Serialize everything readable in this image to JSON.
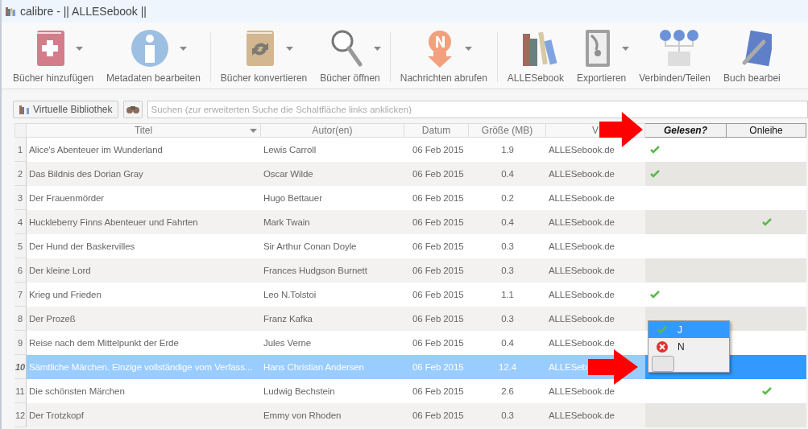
{
  "window": {
    "title": "calibre - || ALLESebook ||"
  },
  "toolbar": [
    {
      "label": "Bücher hinzufügen",
      "kind": "add-book",
      "menu": true,
      "separator_before": false
    },
    {
      "label": "Metadaten bearbeiten",
      "kind": "info",
      "menu": true,
      "separator_before": false
    },
    {
      "label": "Bücher konvertieren",
      "kind": "convert",
      "menu": true,
      "separator_before": true
    },
    {
      "label": "Bücher öffnen",
      "kind": "magnifier",
      "menu": true,
      "separator_before": false
    },
    {
      "label": "Nachrichten abrufen",
      "kind": "news",
      "menu": true,
      "separator_before": true
    },
    {
      "label": "ALLESebook",
      "kind": "library",
      "menu": false,
      "separator_before": true
    },
    {
      "label": "Exportieren",
      "kind": "drive",
      "menu": true,
      "separator_before": false
    },
    {
      "label": "Verbinden/Teilen",
      "kind": "network",
      "menu": false,
      "separator_before": false
    },
    {
      "label": "Buch bearbei",
      "kind": "edit-book",
      "menu": false,
      "separator_before": false
    }
  ],
  "virtual_library": {
    "label": "Virtuelle Bibliothek"
  },
  "search": {
    "placeholder": "Suchen (zur erweiterten Suche die Schaltfläche links anklicken)"
  },
  "table": {
    "columns": [
      {
        "label": "Titel",
        "sorted": true,
        "emphasized": false
      },
      {
        "label": "Autor(en)",
        "sorted": false,
        "emphasized": false
      },
      {
        "label": "Datum",
        "sorted": false,
        "emphasized": false
      },
      {
        "label": "Größe (MB)",
        "sorted": false,
        "emphasized": false
      },
      {
        "label": "V",
        "sorted": false,
        "emphasized": false
      },
      {
        "label": "Gelesen?",
        "sorted": false,
        "emphasized": true
      },
      {
        "label": "Onleihe",
        "sorted": false,
        "emphasized": false
      }
    ],
    "rows": [
      {
        "num": "1",
        "title": "Alice's Abenteuer im Wunderland",
        "author": "Lewis Carroll",
        "date": "06 Feb 2015",
        "size": "1.9",
        "publisher": "ALLESebook.de",
        "read": true,
        "loan": false,
        "selected": false
      },
      {
        "num": "2",
        "title": "Das Bildnis des Dorian Gray",
        "author": "Oscar Wilde",
        "date": "06 Feb 2015",
        "size": "0.4",
        "publisher": "ALLESebook.de",
        "read": true,
        "loan": false,
        "selected": false
      },
      {
        "num": "3",
        "title": "Der Frauenmörder",
        "author": "Hugo Bettauer",
        "date": "06 Feb 2015",
        "size": "0.2",
        "publisher": "ALLESebook.de",
        "read": false,
        "loan": false,
        "selected": false
      },
      {
        "num": "4",
        "title": "Huckleberry Finns Abenteuer und Fahrten",
        "author": "Mark Twain",
        "date": "06 Feb 2015",
        "size": "0.4",
        "publisher": "ALLESebook.de",
        "read": false,
        "loan": true,
        "selected": false
      },
      {
        "num": "5",
        "title": "Der Hund der Baskervilles",
        "author": "Sir Arthur Conan Doyle",
        "date": "06 Feb 2015",
        "size": "0.3",
        "publisher": "ALLESebook.de",
        "read": false,
        "loan": false,
        "selected": false
      },
      {
        "num": "6",
        "title": "Der kleine Lord",
        "author": "Frances Hudgson Burnett",
        "date": "06 Feb 2015",
        "size": "0.3",
        "publisher": "ALLESebook.de",
        "read": false,
        "loan": false,
        "selected": false
      },
      {
        "num": "7",
        "title": "Krieg und Frieden",
        "author": "Leo N.Tolstoi",
        "date": "06 Feb 2015",
        "size": "1.1",
        "publisher": "ALLESebook.de",
        "read": true,
        "loan": false,
        "selected": false
      },
      {
        "num": "8",
        "title": "Der Prozeß",
        "author": "Franz Kafka",
        "date": "06 Feb 2015",
        "size": "0.3",
        "publisher": "ALLESebook.de",
        "read": false,
        "loan": false,
        "selected": false
      },
      {
        "num": "9",
        "title": "Reise nach dem Mittelpunkt der Erde",
        "author": "Jules Verne",
        "date": "06 Feb 2015",
        "size": "0.4",
        "publisher": "ALLESebook.de",
        "read": false,
        "loan": false,
        "selected": false
      },
      {
        "num": "10",
        "title": "Sämtliche Märchen. Einzige vollständige vom Verfass...",
        "author": "Hans Christian Andersen",
        "date": "06 Feb 2015",
        "size": "12.4",
        "publisher": "ALLESeb",
        "read": false,
        "loan": false,
        "selected": true
      },
      {
        "num": "11",
        "title": "Die schönsten Märchen",
        "author": "Ludwig Bechstein",
        "date": "06 Feb 2015",
        "size": "2.6",
        "publisher": "ALLESebook.de",
        "read": false,
        "loan": true,
        "selected": false
      },
      {
        "num": "12",
        "title": "Der Trotzkopf",
        "author": "Emmy von Rhoden",
        "date": "06 Feb 2015",
        "size": "0.3",
        "publisher": "ALLESebook.de",
        "read": false,
        "loan": false,
        "selected": false
      }
    ]
  },
  "dropdown": {
    "options": [
      {
        "kind": "check",
        "label": "J",
        "selected": true
      },
      {
        "kind": "cross",
        "label": "N",
        "selected": false
      },
      {
        "kind": "blank",
        "selected": false
      }
    ]
  }
}
